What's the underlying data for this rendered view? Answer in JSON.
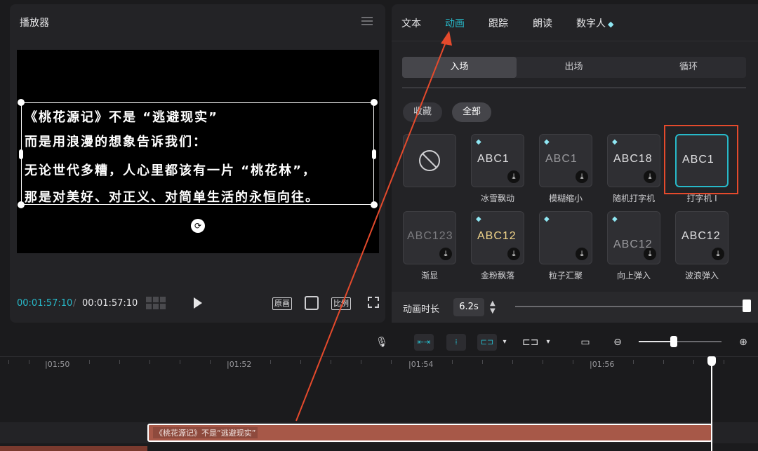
{
  "player": {
    "title": "播放器",
    "subtitle_lines": [
      "《桃花源记》不是 “逃避现实”",
      "而是用浪漫的想象告诉我们：",
      "无论世代多糟，人心里都该有一片 “桃花林”，",
      "那是对美好、对正义、对简单生活的永恒向往。"
    ],
    "time_current": "00:01:57:10",
    "time_separator": "/",
    "time_total": "00:01:57:10",
    "btn_original": "原画",
    "btn_ratio": "比例"
  },
  "side": {
    "tabs": [
      "文本",
      "动画",
      "跟踪",
      "朗读",
      "数字人"
    ],
    "active_tab": "动画",
    "premium_icon": "diamond-icon",
    "segments": [
      "入场",
      "出场",
      "循环"
    ],
    "active_segment": "入场",
    "filters": [
      "收藏",
      "全部"
    ],
    "active_filter": "全部",
    "presets_row1": [
      {
        "label": "",
        "sample": ""
      },
      {
        "label": "冰雪飘动",
        "sample": "ABC1"
      },
      {
        "label": "模糊缩小",
        "sample": "ABC1"
      },
      {
        "label": "随机打字机",
        "sample": "ABC18"
      },
      {
        "label": "打字机 I",
        "sample": "ABC1"
      }
    ],
    "presets_row2": [
      {
        "label": "渐显",
        "sample": "ABC123"
      },
      {
        "label": "金粉飘落",
        "sample": "ABC12"
      },
      {
        "label": "粒子汇聚",
        "sample": ""
      },
      {
        "label": "向上弹入",
        "sample": "ABC12"
      },
      {
        "label": "波浪弹入",
        "sample": "ABC12"
      }
    ],
    "selected_preset": "打字机 I",
    "duration_label": "动画时长",
    "duration_value": "6.2s"
  },
  "timeline": {
    "ticks": [
      "|01:50",
      "|01:52",
      "|01:54",
      "|01:56"
    ],
    "clip_text": "《桃花源记》不是“逃避现实”"
  },
  "colors": {
    "accent": "#27b9c9",
    "highlight": "#e54a2c",
    "clip": "#a75848"
  }
}
